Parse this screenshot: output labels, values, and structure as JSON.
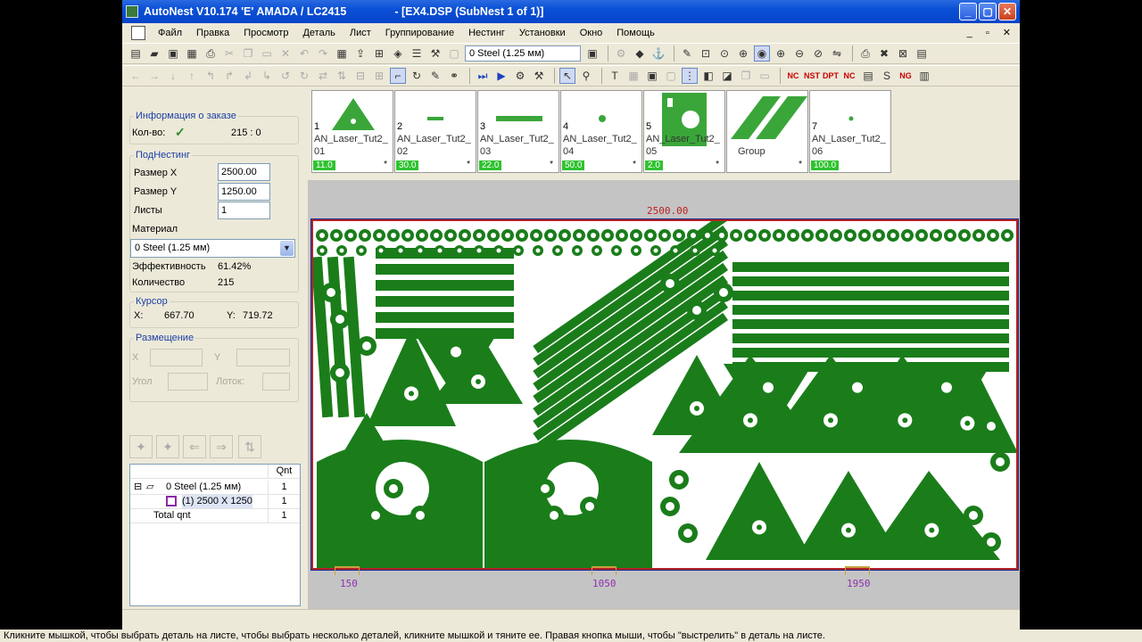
{
  "window": {
    "app_title": "AutoNest V10.174 'E' AMADA / LC2415",
    "doc_title": "- [EX4.DSP (SubNest 1 of 1)]",
    "minimize": "_",
    "maximize": "▢",
    "close": "✕"
  },
  "menu": [
    "Файл",
    "Правка",
    "Просмотр",
    "Деталь",
    "Лист",
    "Группирование",
    "Нестинг",
    "Установки",
    "Окно",
    "Помощь"
  ],
  "toolbar": {
    "material_combo": "0  Steel  (1.25 мм)",
    "nc_labels": [
      "NC",
      "NST",
      "DPT",
      "NC",
      "NG"
    ]
  },
  "order_info": {
    "title": "Информация о заказе",
    "qty_label": "Кол-во:",
    "qty_value": "215 : 0"
  },
  "subnest": {
    "title": "ПодНестинг",
    "size_x_label": "Размер X",
    "size_x_value": "2500.00",
    "size_y_label": "Размер Y",
    "size_y_value": "1250.00",
    "sheets_label": "Листы",
    "sheets_value": "1",
    "material_label": "Материал",
    "material_value": "0  Steel  (1.25 мм)",
    "efficiency_label": "Эффективность",
    "efficiency_value": "61.42%",
    "quantity_label": "Количество",
    "quantity_value": "215"
  },
  "cursor": {
    "title": "Курсор",
    "x_label": "X:",
    "x_value": "667.70",
    "y_label": "Y:",
    "y_value": "719.72"
  },
  "placement": {
    "title": "Размещение",
    "x_label": "X",
    "y_label": "Y",
    "angle_label": "Угол",
    "tray_label": "Лоток:"
  },
  "tree": {
    "qnt_header": "Qnt",
    "rows": [
      {
        "label": "0   Steel  (1.25 мм)",
        "qnt": "1"
      },
      {
        "label": "(1) 2500 X 1250",
        "qnt": "1"
      },
      {
        "label": "Total qnt",
        "qnt": "1"
      }
    ]
  },
  "parts": [
    {
      "num": "1",
      "name": "AN_Laser_Tut2_",
      "sub": "01",
      "qty": "11.0",
      "star": "*"
    },
    {
      "num": "2",
      "name": "AN_Laser_Tut2_",
      "sub": "02",
      "qty": "30.0",
      "star": "*"
    },
    {
      "num": "3",
      "name": "AN_Laser_Tut2_",
      "sub": "03",
      "qty": "22.0",
      "star": "*"
    },
    {
      "num": "4",
      "name": "AN_Laser_Tut2_",
      "sub": "04",
      "qty": "50.0",
      "star": "*"
    },
    {
      "num": "5",
      "name": "AN_Laser_Tut2_",
      "sub": "05",
      "qty": "2.0",
      "star": "*"
    },
    {
      "num": "",
      "name": "Group",
      "sub": "",
      "qty": "",
      "star": "*"
    },
    {
      "num": "7",
      "name": "AN_Laser_Tut2_",
      "sub": "06",
      "qty": "100.0",
      "star": ""
    }
  ],
  "sheet": {
    "width_label": "2500.00",
    "ruler_marks": [
      "150",
      "1050",
      "1950"
    ],
    "part_color": "#1a7d1a"
  },
  "status": "Кликните мышкой, чтобы выбрать деталь на листе, чтобы выбрать несколько деталей, кликните мышкой и тяните ее. Правая кнопка мыши, чтобы \"выстрелить\" в деталь на листе."
}
